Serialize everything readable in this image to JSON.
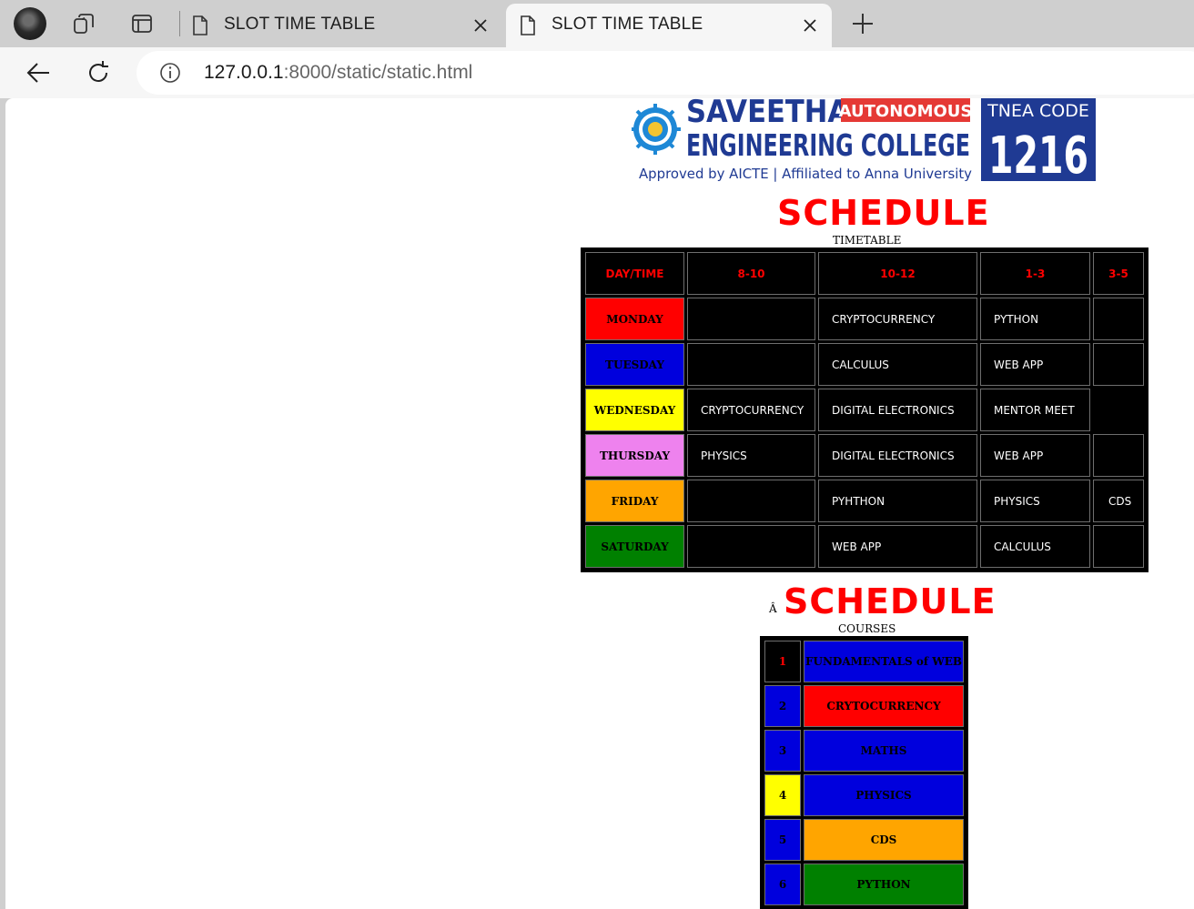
{
  "browser": {
    "tabs": [
      {
        "title": "SLOT TIME TABLE",
        "active": false
      },
      {
        "title": "SLOT TIME TABLE",
        "active": true
      }
    ],
    "url_host": "127.0.0.1",
    "url_path": ":8000/static/static.html"
  },
  "logo": {
    "name_line1": "SAVEETHA",
    "badge": "AUTONOMOUS",
    "name_line2": "ENGINEERING COLLEGE",
    "tagline": "Approved by AICTE | Affiliated to Anna University",
    "code_label": "TNEA CODE",
    "code": "1216"
  },
  "timetable": {
    "heading": "SCHEDULE",
    "caption": "TIMETABLE",
    "header": [
      "DAY/TIME",
      "8-10",
      "10-12",
      "1-3",
      "3-5"
    ],
    "rows": [
      {
        "day": "MONDAY",
        "color": "#ff0000",
        "slots": [
          "",
          "CRYPTOCURRENCY",
          "PYTHON",
          ""
        ]
      },
      {
        "day": "TUESDAY",
        "color": "#0000dd",
        "slots": [
          "",
          "CALCULUS",
          "WEB APP",
          ""
        ]
      },
      {
        "day": "WEDNESDAY",
        "color": "#ffff00",
        "slots": [
          "CRYPTOCURRENCY",
          "DIGITAL ELECTRONICS",
          "MENTOR MEET",
          ""
        ]
      },
      {
        "day": "THURSDAY",
        "color": "#ee82ee",
        "slots": [
          "PHYSICS",
          "DIGITAL ELECTRONICS",
          "WEB APP",
          ""
        ]
      },
      {
        "day": "FRIDAY",
        "color": "#ffa500",
        "slots": [
          "",
          "PYHTHON",
          "PHYSICS",
          "CDS"
        ]
      },
      {
        "day": "SATURDAY",
        "color": "#008000",
        "slots": [
          "",
          "WEB APP",
          "CALCULUS",
          ""
        ]
      }
    ]
  },
  "courses": {
    "prefix": "Â",
    "heading": "SCHEDULE",
    "caption": "COURSES",
    "rows": [
      {
        "num": "1",
        "num_bg": "#000000",
        "num_color": "#ff0000",
        "name": "FUNDAMENTALS of WEB",
        "name_bg": "#0000dd"
      },
      {
        "num": "2",
        "num_bg": "#0000dd",
        "num_color": "#000000",
        "name": "CRYTOCURRENCY",
        "name_bg": "#ff0000"
      },
      {
        "num": "3",
        "num_bg": "#0000dd",
        "num_color": "#000000",
        "name": "MATHS",
        "name_bg": "#0000dd"
      },
      {
        "num": "4",
        "num_bg": "#ffff00",
        "num_color": "#000000",
        "name": "PHYSICS",
        "name_bg": "#0000dd"
      },
      {
        "num": "5",
        "num_bg": "#0000dd",
        "num_color": "#000000",
        "name": "CDS",
        "name_bg": "#ffa500"
      },
      {
        "num": "6",
        "num_bg": "#0000dd",
        "num_color": "#000000",
        "name": "PYTHON",
        "name_bg": "#008000"
      }
    ]
  }
}
